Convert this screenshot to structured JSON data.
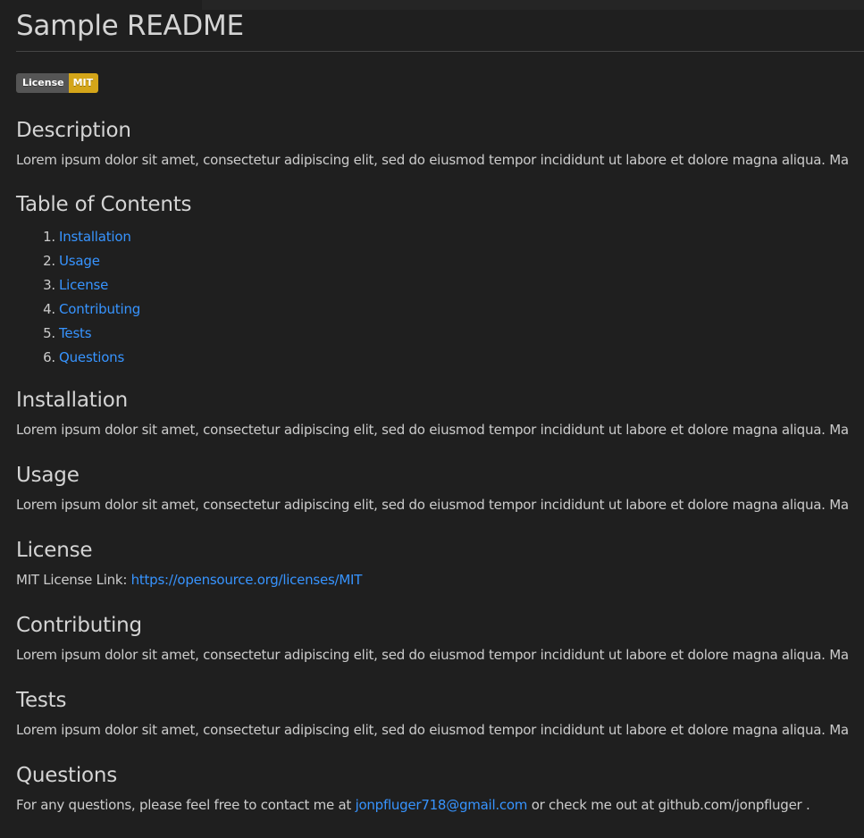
{
  "page": {
    "title": "Sample README",
    "colors": {
      "background": "#1f1f1f",
      "text": "#cccccc",
      "heading": "#d4d4d4",
      "link": "#3794ff",
      "badge_label_bg": "#555555",
      "badge_value_bg": "#d4a519"
    }
  },
  "badge": {
    "label": "License",
    "value": "MIT"
  },
  "description": {
    "heading": "Description",
    "body": "Lorem ipsum dolor sit amet, consectetur adipiscing elit, sed do eiusmod tempor incididunt ut labore et dolore magna aliqua. Ma"
  },
  "toc": {
    "heading": "Table of Contents",
    "items": [
      {
        "num": "1.",
        "label": "Installation"
      },
      {
        "num": "2.",
        "label": "Usage"
      },
      {
        "num": "3.",
        "label": "License"
      },
      {
        "num": "4.",
        "label": "Contributing"
      },
      {
        "num": "5.",
        "label": "Tests"
      },
      {
        "num": "6.",
        "label": "Questions"
      }
    ]
  },
  "installation": {
    "heading": "Installation",
    "body": "Lorem ipsum dolor sit amet, consectetur adipiscing elit, sed do eiusmod tempor incididunt ut labore et dolore magna aliqua. Ma"
  },
  "usage": {
    "heading": "Usage",
    "body": "Lorem ipsum dolor sit amet, consectetur adipiscing elit, sed do eiusmod tempor incididunt ut labore et dolore magna aliqua. Ma"
  },
  "license": {
    "heading": "License",
    "prefix": "MIT License Link: ",
    "link": "https://opensource.org/licenses/MIT"
  },
  "contributing": {
    "heading": "Contributing",
    "body": "Lorem ipsum dolor sit amet, consectetur adipiscing elit, sed do eiusmod tempor incididunt ut labore et dolore magna aliqua. Ma"
  },
  "tests": {
    "heading": "Tests",
    "body": "Lorem ipsum dolor sit amet, consectetur adipiscing elit, sed do eiusmod tempor incididunt ut labore et dolore magna aliqua. Ma"
  },
  "questions": {
    "heading": "Questions",
    "prefix": "For any questions, please feel free to contact me at ",
    "email": "jonpfluger718@gmail.com",
    "suffix": " or check me out at github.com/jonpfluger ."
  }
}
